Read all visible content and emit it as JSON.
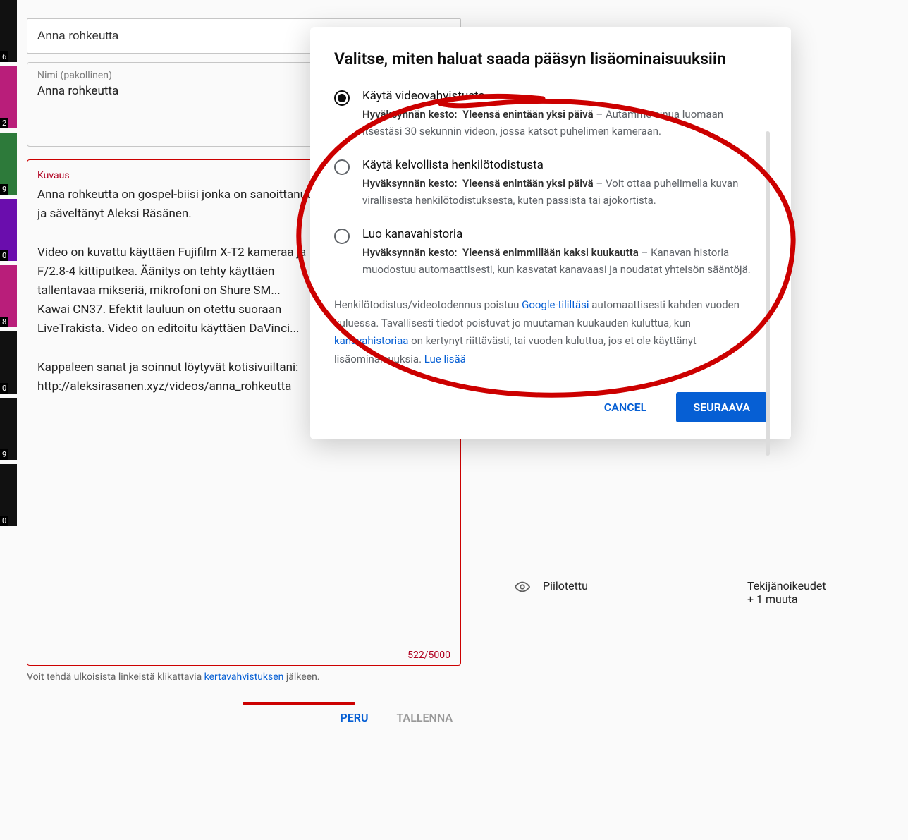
{
  "sidebar": {
    "thumbs": [
      {
        "badge": "6",
        "tone": "dark"
      },
      {
        "badge": "2",
        "tone": "pink"
      },
      {
        "badge": "9",
        "tone": "green"
      },
      {
        "badge": "0",
        "tone": "purple"
      },
      {
        "badge": "8",
        "tone": "pink"
      },
      {
        "badge": "0",
        "tone": "dark"
      },
      {
        "badge": "9",
        "tone": "dark"
      },
      {
        "badge": "0",
        "tone": "dark"
      }
    ]
  },
  "editor": {
    "title_value": "Anna rohkeutta",
    "name_label": "Nimi (pakollinen)",
    "name_value": "Anna rohkeutta",
    "desc_label": "Kuvaus",
    "desc_body": "Anna rohkeutta on gospel-biisi jonka on sanoittanut\nja säveltänyt Aleksi Räsänen.\n\nVideo on kuvattu käyttäen Fujifilm X-T2 kameraa ja\nF/2.8-4 kittiputkea. Äänitys on tehty käyttäen\ntallentavaa mikseriä, mikrofoni on Shure SM...\nKawai CN37. Efektit lauluun on otettu suoraan\nLiveTrakista. Video on editoitu käyttäen DaVinci...\n\nKappaleen sanat ja soinnut löytyvät kotisivuiltani:\nhttp://aleksirasanen.xyz/videos/anna_rohkeutta",
    "counter": "522/5000",
    "link_note_pre": "Voit tehdä ulkoisista linkeistä klikattavia ",
    "link_note_link": "kertavahvistuksen",
    "link_note_post": " jälkeen.",
    "btn_cancel": "PERU",
    "btn_save": "TALLENNA"
  },
  "visibility": {
    "status": "Piilotettu",
    "right_line1": "Tekijänoikeudet",
    "right_line2": "+ 1 muuta"
  },
  "modal": {
    "heading": "Valitse, miten haluat saada pääsyn lisäominaisuuksiin",
    "options": [
      {
        "title": "Käytä videovahvistusta",
        "kesto_label": "Hyväksynnän kesto:",
        "kesto_bold": "Yleensä enintään yksi päivä",
        "tail": " – Autamme sinua luomaan itsestäsi 30 sekunnin videon, jossa katsot puhelimen kameraan.",
        "checked": true
      },
      {
        "title": "Käytä kelvollista henkilötodistusta",
        "kesto_label": "Hyväksynnän kesto:",
        "kesto_bold": "Yleensä enintään yksi päivä",
        "tail": " – Voit ottaa puhelimella kuvan virallisesta henkilötodistuksesta, kuten passista tai ajokortista.",
        "checked": false
      },
      {
        "title": "Luo kanavahistoria",
        "kesto_label": "Hyväksynnän kesto:",
        "kesto_bold": "Yleensä enimmillään kaksi kuukautta",
        "tail": " – Kanavan historia muodostuu automaattisesti, kun kasvatat kanavaasi ja noudatat yhteisön sääntöjä.",
        "checked": false
      }
    ],
    "footer_pre": "Henkilötodistus/videotodennus poistuu ",
    "footer_link1": "Google-tililtäsi",
    "footer_mid1": " automaattisesti kahden vuoden kuluessa. Tavallisesti tiedot poistuvat jo muutaman kuukauden kuluttua, kun ",
    "footer_link2": "kanavahistoriaa",
    "footer_mid2": " on kertynyt riittävästi, tai vuoden kuluttua, jos et ole käyttänyt lisäominaisuuksia. ",
    "footer_link3": "Lue lisää",
    "btn_cancel": "CANCEL",
    "btn_next": "SEURAAVA"
  }
}
